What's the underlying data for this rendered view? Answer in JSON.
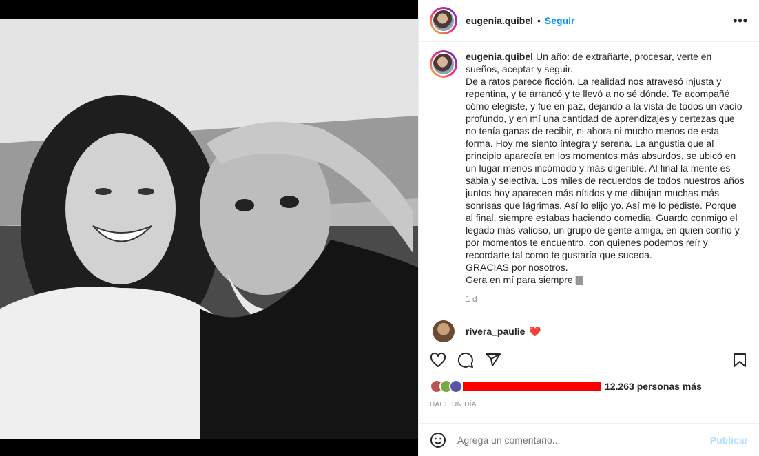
{
  "post": {
    "username": "eugenia.quibel",
    "follow_label": "Seguir",
    "separator": "•",
    "more_label": "•••"
  },
  "caption": {
    "username": "eugenia.quibel",
    "text": "Un año: de extrañarte, procesar, verte en sueños, aceptar y seguir.\nDe a ratos parece ficción. La realidad nos atravesó injusta y repentina, y te arrancó y te llevó a no sé dónde. Te acompañé cómo elegiste, y fue en paz, dejando a la vista de todos un vacío profundo, y en mí una cantidad de aprendizajes y certezas que no tenía ganas de recibir, ni ahora ni mucho menos de esta forma. Hoy me siento íntegra y serena. La angustia que al principio aparecía en los momentos más absurdos, se ubicó en un lugar menos incómodo y más digerible. Al final la mente es sabia y selectiva. Los miles de recuerdos de todos nuestros años juntos hoy aparecen más nítidos y me dibujan muchas más sonrisas que lágrimas. Así lo elijo yo. Así me lo pediste. Porque al final, siempre estabas haciendo comedia. Guardo conmigo el legado más valioso, un grupo de gente amiga, en quien confío y por momentos te encuentro, con quienes podemos reír y recordarte tal como te gustaría que suceda.\nGRACIAS por nosotros.\nGera en mí para siempre 🀫",
    "time": "1 d"
  },
  "next_comment": {
    "username": "rivera_paulie",
    "emoji": "❤️"
  },
  "actions": {
    "like_icon": "heart-icon",
    "comment_icon": "comment-icon",
    "share_icon": "share-icon",
    "save_icon": "bookmark-icon"
  },
  "likes": {
    "others_count": "12.263 personas más"
  },
  "timestamp": "Hace un día",
  "add_comment": {
    "placeholder": "Agrega un comentario...",
    "post_label": "Publicar",
    "emoji_icon": "smiley-icon"
  },
  "colors": {
    "accent": "#0095f6",
    "post_disabled": "#b2dffc",
    "redaction": "#ff0000"
  }
}
